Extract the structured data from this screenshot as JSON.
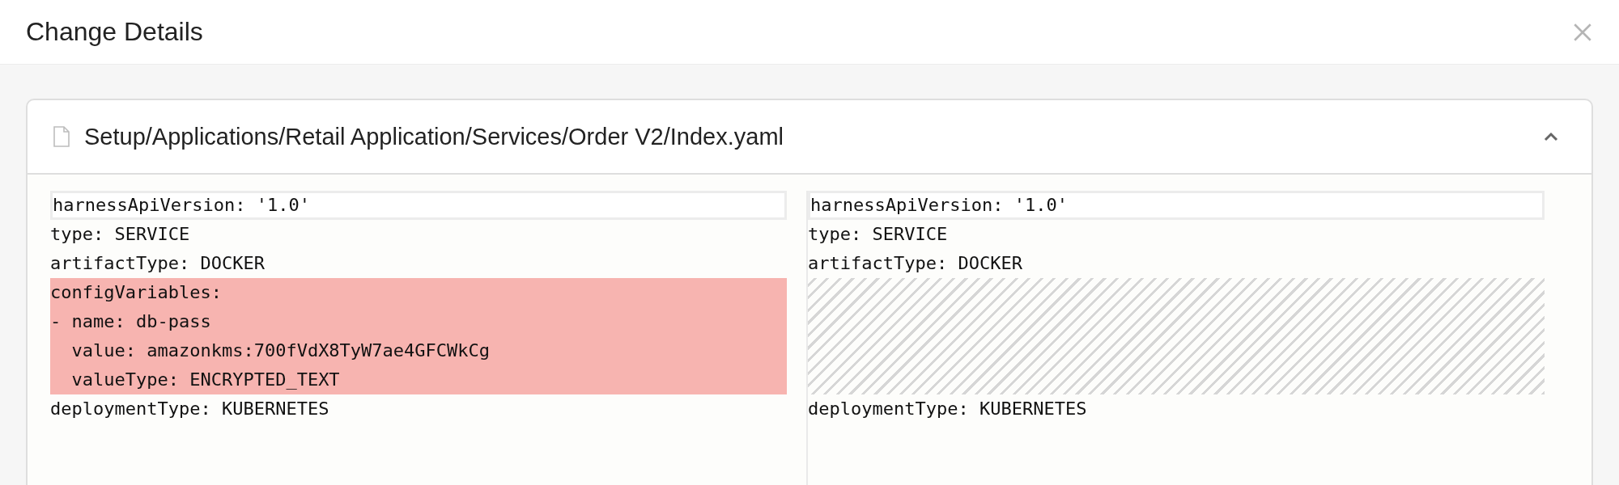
{
  "dialog": {
    "title": "Change Details"
  },
  "file": {
    "path": "Setup/Applications/Retail Application/Services/Order V2/Index.yaml",
    "expanded": true
  },
  "panes": [
    {
      "lines": [
        {
          "kind": "text",
          "text": "harnessApiVersion: '1.0'",
          "current": true
        },
        {
          "kind": "text",
          "text": "type: SERVICE",
          "current": false
        },
        {
          "kind": "text",
          "text": "artifactType: DOCKER",
          "current": false
        },
        {
          "kind": "removed",
          "text": "configVariables:",
          "current": false
        },
        {
          "kind": "removed",
          "text": "- name: db-pass",
          "current": false
        },
        {
          "kind": "removed",
          "text": "  value: amazonkms:700fVdX8TyW7ae4GFCWkCg",
          "current": false
        },
        {
          "kind": "removed",
          "text": "  valueType: ENCRYPTED_TEXT",
          "current": false
        },
        {
          "kind": "text",
          "text": "deploymentType: KUBERNETES",
          "current": false
        }
      ]
    },
    {
      "lines": [
        {
          "kind": "text",
          "text": "harnessApiVersion: '1.0'",
          "current": true
        },
        {
          "kind": "text",
          "text": "type: SERVICE",
          "current": false
        },
        {
          "kind": "text",
          "text": "artifactType: DOCKER",
          "current": false
        },
        {
          "kind": "filler"
        },
        {
          "kind": "filler"
        },
        {
          "kind": "filler"
        },
        {
          "kind": "filler"
        },
        {
          "kind": "text",
          "text": "deploymentType: KUBERNETES",
          "current": false
        }
      ]
    }
  ]
}
